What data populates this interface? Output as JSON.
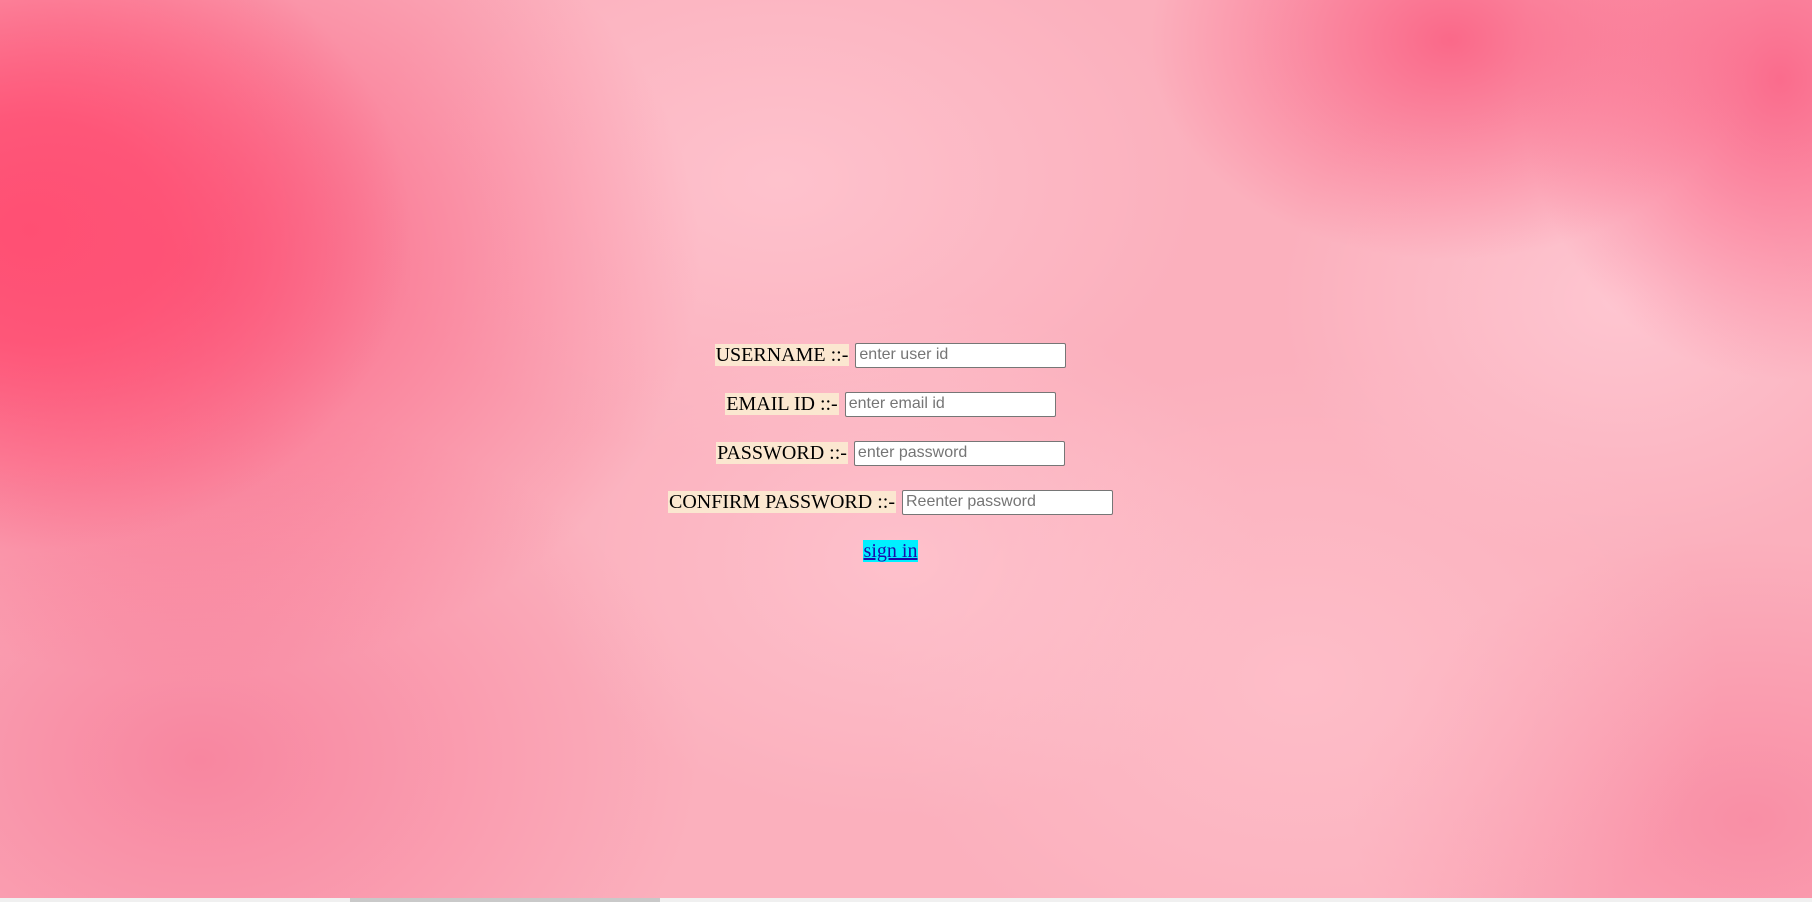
{
  "form": {
    "username": {
      "label": "USERNAME ::-",
      "placeholder": "enter user id",
      "value": ""
    },
    "email": {
      "label": "EMAIL ID ::-",
      "placeholder": "enter email id",
      "value": ""
    },
    "password": {
      "label": "PASSWORD ::-",
      "placeholder": "enter password",
      "value": ""
    },
    "confirm_password": {
      "label": "CONFIRM PASSWORD ::-",
      "placeholder": "Reenter password",
      "value": ""
    },
    "submit_label": "sign in"
  },
  "colors": {
    "background": "#fbb0bd",
    "label_highlight": "#fbe7d0",
    "signin_highlight": "#00f0ff",
    "link": "#1a0dab"
  }
}
